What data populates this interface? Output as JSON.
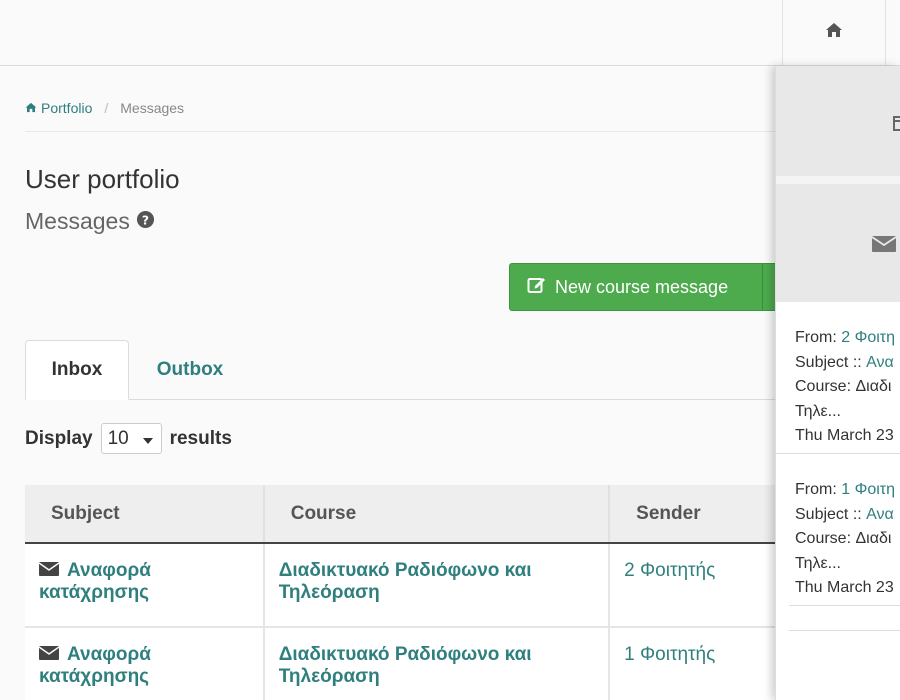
{
  "breadcrumb": {
    "home": "Portfolio",
    "current": "Messages"
  },
  "page": {
    "title": "User portfolio",
    "subtitle": "Messages"
  },
  "actions": {
    "new_message": "New course message"
  },
  "tabs": [
    {
      "label": "Inbox",
      "active": true
    },
    {
      "label": "Outbox",
      "active": false
    }
  ],
  "display": {
    "prefix": "Display",
    "value": "10",
    "suffix": "results"
  },
  "table": {
    "columns": [
      "Subject",
      "Course",
      "Sender"
    ],
    "rows": [
      {
        "subject": [
          "Αναφορά",
          "κατάχρησης"
        ],
        "course": [
          "Διαδικτυακό Ραδιόφωνο και",
          "Τηλεόραση"
        ],
        "sender": "2 Φοιτητής"
      },
      {
        "subject": [
          "Αναφορά",
          "κατάχρησης"
        ],
        "course": [
          "Διαδικτυακό Ραδιόφωνο και",
          "Τηλεόραση"
        ],
        "sender": "1 Φοιτητής"
      }
    ]
  },
  "panel": {
    "messages": [
      {
        "from_label": "From:",
        "from": "2 Φοιτη",
        "subject_label": "Subject ::",
        "subject": "Ανα",
        "course_label": "Course:",
        "course": "Διαδι",
        "course_cont": "Τηλε...",
        "date": "Thu March 23"
      },
      {
        "from_label": "From:",
        "from": "1 Φοιτη",
        "subject_label": "Subject ::",
        "subject": "Ανα",
        "course_label": "Course:",
        "course": "Διαδι",
        "course_cont": "Τηλε...",
        "date": "Thu March 23"
      }
    ]
  },
  "colors": {
    "accent": "#2f7f7e",
    "button": "#4daa4d"
  }
}
